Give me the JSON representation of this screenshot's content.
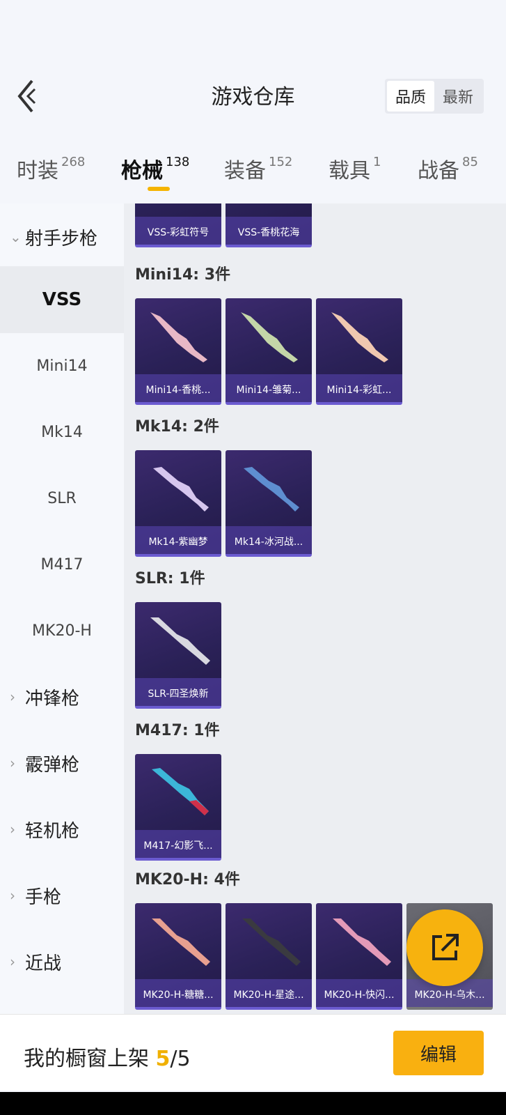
{
  "header": {
    "title": "游戏仓库",
    "sort_options": [
      "品质",
      "最新"
    ]
  },
  "tabs": [
    {
      "label": "时装",
      "count": "268"
    },
    {
      "label": "枪械",
      "count": "138"
    },
    {
      "label": "装备",
      "count": "152"
    },
    {
      "label": "载具",
      "count": "1"
    },
    {
      "label": "战备",
      "count": "85"
    }
  ],
  "sidebar": {
    "categories": {
      "sniper": "射手步枪",
      "smg": "冲锋枪",
      "shotgun": "霰弹枪",
      "lmg": "轻机枪",
      "pistol": "手枪",
      "melee": "近战"
    },
    "items": [
      "VSS",
      "Mini14",
      "Mk14",
      "SLR",
      "M417",
      "MK20-H"
    ]
  },
  "content": {
    "vss_cards": [
      "VSS-彩虹符号",
      "VSS-香桃花海"
    ],
    "mini14": {
      "title": "Mini14: 3件",
      "cards": [
        "Mini14-香桃...",
        "Mini14-雏菊...",
        "Mini14-彩虹..."
      ]
    },
    "mk14": {
      "title": "Mk14: 2件",
      "cards": [
        "Mk14-紫幽梦",
        "Mk14-冰河战..."
      ]
    },
    "slr": {
      "title": "SLR: 1件",
      "cards": [
        "SLR-四圣焕新"
      ]
    },
    "m417": {
      "title": "M417: 1件",
      "cards": [
        "M417-幻影飞..."
      ]
    },
    "mk20h": {
      "title": "MK20-H: 4件",
      "cards": [
        "MK20-H-糖糖...",
        "MK20-H-星途...",
        "MK20-H-快闪...",
        "MK20-H-乌木..."
      ]
    }
  },
  "footer": {
    "label": "我的橱窗上架",
    "current": "5",
    "separator": "/",
    "total": "5",
    "edit_label": "编辑"
  },
  "colors": {
    "accent": "#f5b400",
    "card_bg": "#2a2157"
  },
  "icons": {
    "back": "chevron-left-icon",
    "share": "external-link-icon"
  }
}
